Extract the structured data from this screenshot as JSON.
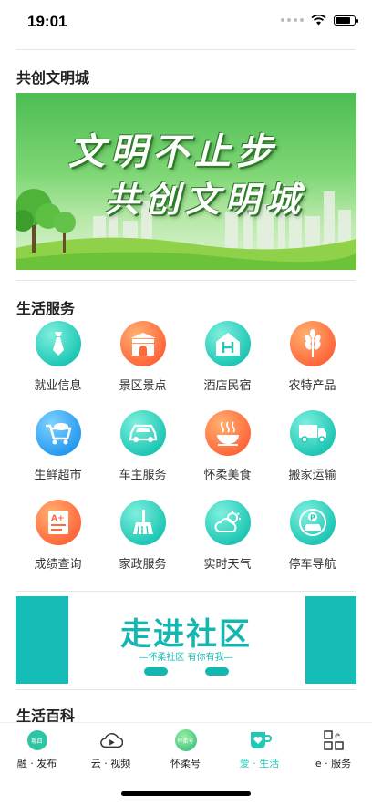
{
  "status": {
    "time": "19:01"
  },
  "sections": {
    "civilization_title": "共创文明城",
    "life_services_title": "生活服务",
    "encyclopedia_title": "生活百科"
  },
  "banner1": {
    "line1": "文明不止步",
    "line2": "共创文明城"
  },
  "services": [
    {
      "label": "就业信息",
      "icon": "tie-icon",
      "color": "teal"
    },
    {
      "label": "景区景点",
      "icon": "gate-icon",
      "color": "orange"
    },
    {
      "label": "酒店民宿",
      "icon": "hotel-icon",
      "color": "teal"
    },
    {
      "label": "农特产品",
      "icon": "wheat-icon",
      "color": "orange"
    },
    {
      "label": "生鲜超市",
      "icon": "cart-icon",
      "color": "blue"
    },
    {
      "label": "车主服务",
      "icon": "car-icon",
      "color": "teal"
    },
    {
      "label": "怀柔美食",
      "icon": "bowl-icon",
      "color": "orange"
    },
    {
      "label": "搬家运输",
      "icon": "truck-icon",
      "color": "teal"
    },
    {
      "label": "成绩查询",
      "icon": "grade-icon",
      "color": "orange"
    },
    {
      "label": "家政服务",
      "icon": "broom-icon",
      "color": "teal"
    },
    {
      "label": "实时天气",
      "icon": "weather-icon",
      "color": "teal"
    },
    {
      "label": "停车导航",
      "icon": "parking-icon",
      "color": "teal"
    }
  ],
  "banner2": {
    "title": "走进社区",
    "subtitle": "—怀柔社区 有你有我—"
  },
  "tabs": [
    {
      "label": "融 · 发布",
      "badge": "融四"
    },
    {
      "label": "云 · 视频"
    },
    {
      "label": "怀柔号",
      "badge": "怀柔号"
    },
    {
      "label": "爱 · 生活",
      "active": true
    },
    {
      "label": "e · 服务"
    }
  ],
  "colors": {
    "accent": "#13b7b0",
    "teal": "#22c8b6",
    "orange": "#ff6a3d",
    "blue": "#2a9cf0"
  }
}
